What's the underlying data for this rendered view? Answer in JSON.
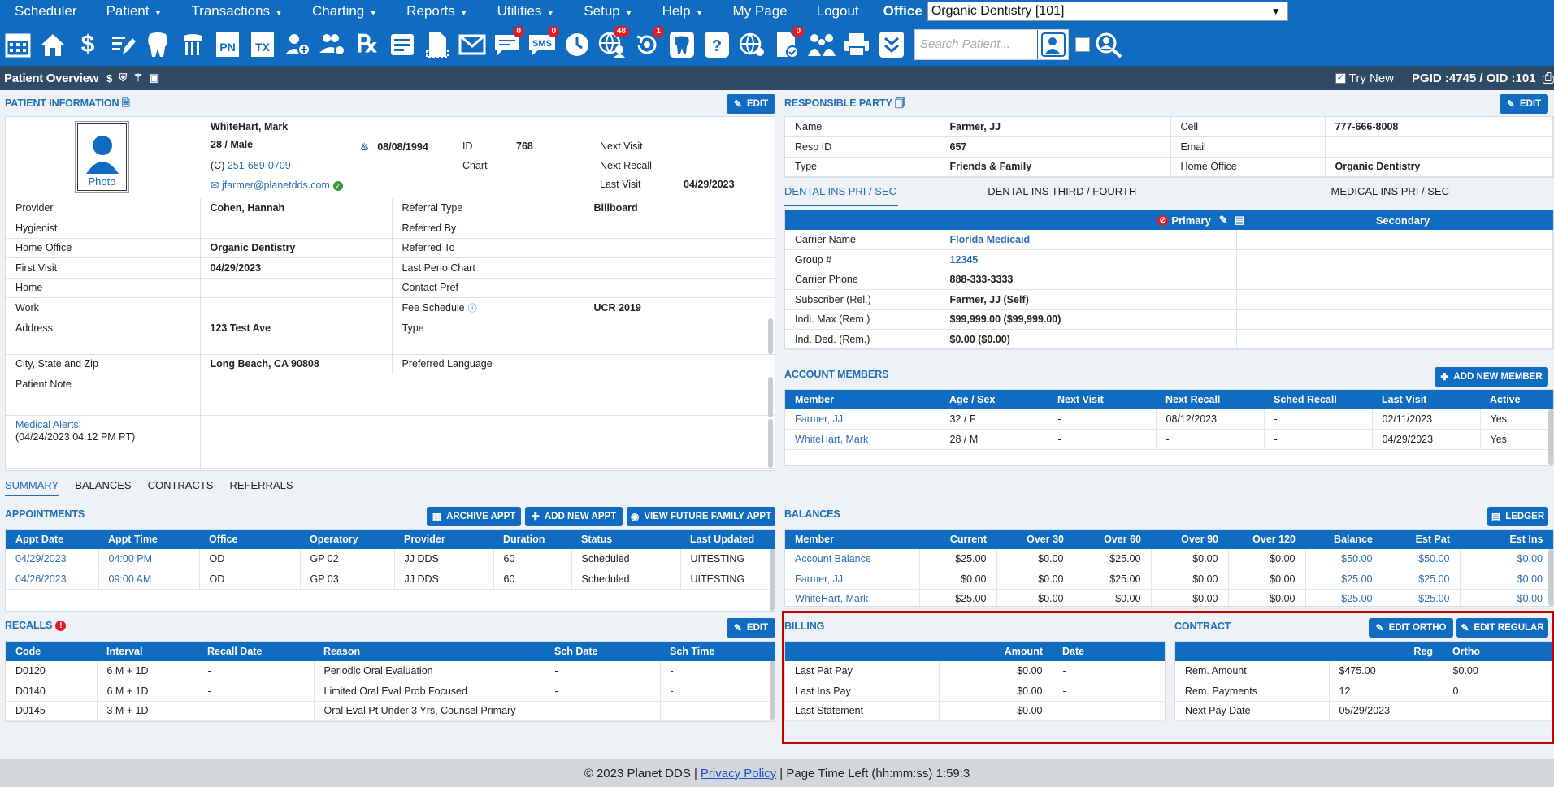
{
  "nav": {
    "menu": [
      {
        "label": "Scheduler",
        "caret": false
      },
      {
        "label": "Patient",
        "caret": true
      },
      {
        "label": "Transactions",
        "caret": true
      },
      {
        "label": "Charting",
        "caret": true
      },
      {
        "label": "Reports",
        "caret": true
      },
      {
        "label": "Utilities",
        "caret": true
      },
      {
        "label": "Setup",
        "caret": true
      },
      {
        "label": "Help",
        "caret": true
      },
      {
        "label": "My Page",
        "caret": false
      },
      {
        "label": "Logout",
        "caret": false
      }
    ],
    "office_label": "Office",
    "office_value": "Organic Dentistry [101]"
  },
  "toolbar": {
    "search_placeholder": "Search Patient...",
    "badges": {
      "messages": "0",
      "sms": "0",
      "online": "48",
      "recall": "1",
      "forms": "0"
    }
  },
  "overview": {
    "title": "Patient Overview",
    "try_new": "Try New",
    "pgid": "PGID :4745  /  OID :101"
  },
  "patient": {
    "header": "PATIENT INFORMATION",
    "edit": "EDIT",
    "photo": "Photo",
    "name": "WhiteHart, Mark",
    "age_sex": "28 / Male",
    "dob": "08/08/1994",
    "id_label": "ID",
    "id": "768",
    "chart_label": "Chart",
    "phone_prefix": "(C)",
    "phone": "251-689-0709",
    "email": "jfarmer@planetdds.com",
    "next_visit_label": "Next Visit",
    "next_recall_label": "Next Recall",
    "last_visit_label": "Last Visit",
    "last_visit": "04/29/2023",
    "rows": [
      [
        "Provider",
        "Cohen, Hannah",
        "Referral Type",
        "Billboard"
      ],
      [
        "Hygienist",
        "",
        "Referred By",
        ""
      ],
      [
        "Home Office",
        "Organic Dentistry",
        "Referred To",
        ""
      ],
      [
        "First Visit",
        "04/29/2023",
        "Last Perio Chart",
        ""
      ],
      [
        "Home",
        "",
        "Contact Pref",
        ""
      ],
      [
        "Work",
        "",
        "Fee Schedule",
        "UCR 2019"
      ]
    ],
    "address_label": "Address",
    "address": "123 Test Ave",
    "type_label": "Type",
    "csz_label": "City, State and Zip",
    "csz": "Long Beach, CA 90808",
    "lang_label": "Preferred Language",
    "note_label": "Patient Note",
    "alerts_label": "Medical Alerts:",
    "alerts_time": "(04/24/2023 04:12 PM PT)"
  },
  "responsible": {
    "header": "RESPONSIBLE PARTY",
    "edit": "EDIT",
    "rows": [
      [
        "Name",
        "Farmer, JJ",
        "Cell",
        "777-666-8008"
      ],
      [
        "Resp ID",
        "657",
        "Email",
        ""
      ],
      [
        "Type",
        "Friends & Family",
        "Home Office",
        "Organic Dentistry"
      ]
    ]
  },
  "insurance": {
    "tabs": [
      "DENTAL INS PRI / SEC",
      "DENTAL INS THIRD / FOURTH",
      "MEDICAL INS PRI / SEC"
    ],
    "primary": "Primary",
    "secondary": "Secondary",
    "rows": [
      [
        "Carrier Name",
        "Florida Medicaid",
        ""
      ],
      [
        "Group #",
        "12345",
        ""
      ],
      [
        "Carrier Phone",
        "888-333-3333",
        ""
      ],
      [
        "Subscriber (Rel.)",
        "Farmer, JJ (Self)",
        ""
      ],
      [
        "Indi. Max (Rem.)",
        "$99,999.00 ($99,999.00)",
        ""
      ],
      [
        "Ind. Ded. (Rem.)",
        "$0.00 ($0.00)",
        ""
      ]
    ]
  },
  "members": {
    "header": "ACCOUNT MEMBERS",
    "add": "ADD NEW MEMBER",
    "cols": [
      "Member",
      "Age / Sex",
      "Next Visit",
      "Next Recall",
      "Sched Recall",
      "Last Visit",
      "Active"
    ],
    "rows": [
      [
        "Farmer, JJ",
        "32 / F",
        "-",
        "08/12/2023",
        "-",
        "02/11/2023",
        "Yes"
      ],
      [
        "WhiteHart, Mark",
        "28 / M",
        "-",
        "-",
        "-",
        "04/29/2023",
        "Yes"
      ]
    ]
  },
  "tabs": [
    "SUMMARY",
    "BALANCES",
    "CONTRACTS",
    "REFERRALS"
  ],
  "appointments": {
    "header": "APPOINTMENTS",
    "archive": "ARCHIVE APPT",
    "add": "ADD NEW APPT",
    "future": "VIEW FUTURE FAMILY APPT",
    "cols": [
      "Appt Date",
      "Appt Time",
      "Office",
      "Operatory",
      "Provider",
      "Duration",
      "Status",
      "Last Updated"
    ],
    "rows": [
      [
        "04/29/2023",
        "04:00 PM",
        "OD",
        "GP 02",
        "JJ DDS",
        "60",
        "Scheduled",
        "UITESTING"
      ],
      [
        "04/26/2023",
        "09:00 AM",
        "OD",
        "GP 03",
        "JJ DDS",
        "60",
        "Scheduled",
        "UITESTING"
      ]
    ]
  },
  "recalls": {
    "header": "RECALLS",
    "badge": "!",
    "edit": "EDIT",
    "cols": [
      "Code",
      "Interval",
      "Recall Date",
      "Reason",
      "Sch Date",
      "Sch Time"
    ],
    "rows": [
      [
        "D0120",
        "6 M + 1D",
        "-",
        "Periodic Oral Evaluation",
        "-",
        "-"
      ],
      [
        "D0140",
        "6 M + 1D",
        "-",
        "Limited Oral Eval Prob Focused",
        "-",
        "-"
      ],
      [
        "D0145",
        "3 M + 1D",
        "-",
        "Oral Eval Pt Under 3 Yrs, Counsel Primary",
        "-",
        "-"
      ]
    ]
  },
  "balances": {
    "header": "BALANCES",
    "ledger": "LEDGER",
    "cols": [
      "Member",
      "Current",
      "Over 30",
      "Over 60",
      "Over 90",
      "Over 120",
      "Balance",
      "Est Pat",
      "Est Ins"
    ],
    "rows": [
      [
        "Account Balance",
        "$25.00",
        "$0.00",
        "$25.00",
        "$0.00",
        "$0.00",
        "$50.00",
        "$50.00",
        "$0.00"
      ],
      [
        "Farmer, JJ",
        "$0.00",
        "$0.00",
        "$25.00",
        "$0.00",
        "$0.00",
        "$25.00",
        "$25.00",
        "$0.00"
      ],
      [
        "WhiteHart, Mark",
        "$25.00",
        "$0.00",
        "$0.00",
        "$0.00",
        "$0.00",
        "$25.00",
        "$25.00",
        "$0.00"
      ]
    ]
  },
  "billing": {
    "header": "BILLING",
    "cols": [
      "",
      "Amount",
      "Date"
    ],
    "rows": [
      [
        "Last Pat Pay",
        "$0.00",
        "-"
      ],
      [
        "Last Ins Pay",
        "$0.00",
        "-"
      ],
      [
        "Last Statement",
        "$0.00",
        "-"
      ]
    ]
  },
  "contract": {
    "header": "CONTRACT",
    "edit_ortho": "EDIT ORTHO",
    "edit_regular": "EDIT REGULAR",
    "cols": [
      "",
      "Reg",
      "Ortho"
    ],
    "rows": [
      [
        "Rem. Amount",
        "$475.00",
        "$0.00"
      ],
      [
        "Rem. Payments",
        "12",
        "0"
      ],
      [
        "Next Pay Date",
        "05/29/2023",
        "-"
      ]
    ]
  },
  "footer": {
    "copy": "© 2023 Planet DDS |",
    "privacy": "Privacy Policy",
    "time": "|  Page Time Left (hh:mm:ss) 1:59:3"
  },
  "colors": {
    "primary": "#0f6cc0",
    "header_dark": "#2f4a64",
    "link": "#2a6db0",
    "highlight": "#c00000"
  }
}
